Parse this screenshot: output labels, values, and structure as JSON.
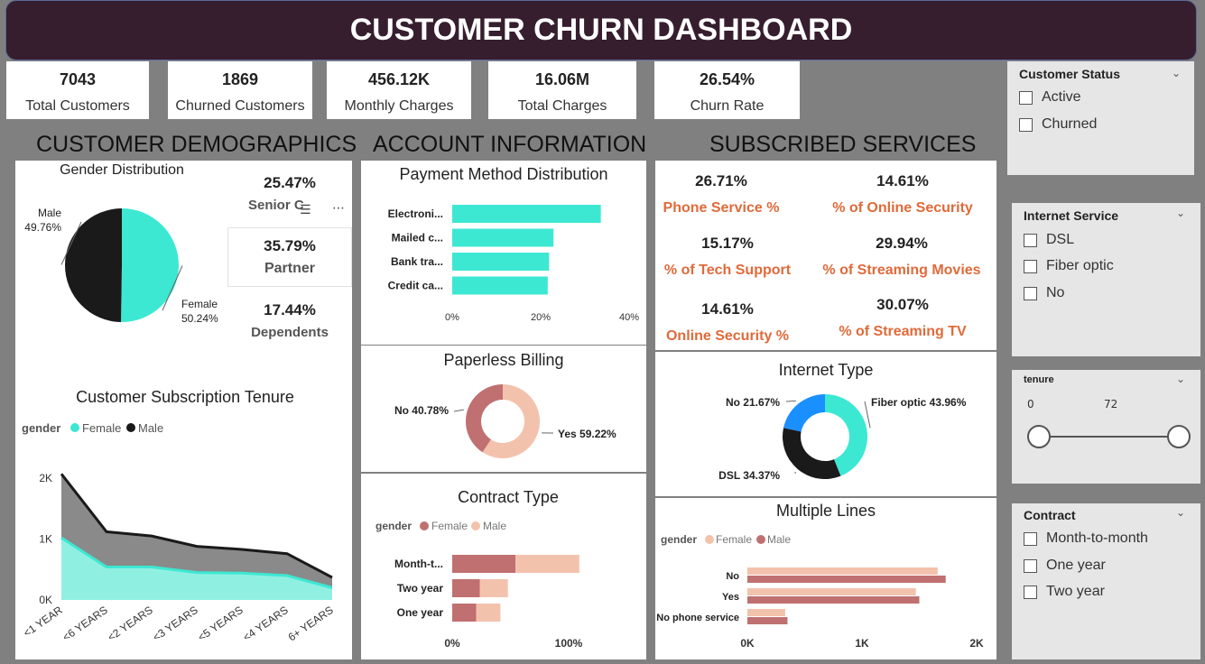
{
  "header": {
    "title": "CUSTOMER CHURN DASHBOARD"
  },
  "kpis": [
    {
      "value": "7043",
      "label": "Total Customers"
    },
    {
      "value": "1869",
      "label": "Churned Customers"
    },
    {
      "value": "456.12K",
      "label": "Monthly Charges"
    },
    {
      "value": "16.06M",
      "label": "Total Charges"
    },
    {
      "value": "26.54%",
      "label": "Churn Rate"
    }
  ],
  "sections": {
    "demographics": "CUSTOMER DEMOGRAPHICS",
    "account": "ACCOUNT INFORMATION",
    "services": "SUBSCRIBED SERVICES"
  },
  "demo_cards": {
    "senior_value": "25.47%",
    "senior_label": "Senior C",
    "partner_value": "35.79%",
    "partner_label": "Partner",
    "dependents_value": "17.44%",
    "dependents_label": "Dependents"
  },
  "services": [
    {
      "value": "26.71%",
      "label": "Phone Service  %"
    },
    {
      "value": "14.61%",
      "label": "% of Online Security"
    },
    {
      "value": "15.17%",
      "label": "% of Tech Support"
    },
    {
      "value": "29.94%",
      "label": "% of Streaming Movies"
    },
    {
      "value": "14.61%",
      "label": "Online Security %"
    },
    {
      "value": "30.07%",
      "label": "% of Streaming TV"
    }
  ],
  "slicers": {
    "status": {
      "title": "Customer Status",
      "options": [
        "Active",
        "Churned"
      ]
    },
    "internet": {
      "title": "Internet Service",
      "options": [
        "DSL",
        "Fiber optic",
        "No"
      ]
    },
    "tenure": {
      "title": "tenure",
      "min": "0",
      "max": "72"
    },
    "contract": {
      "title": "Contract",
      "options": [
        "Month-to-month",
        "One year",
        "Two year"
      ]
    }
  },
  "colors": {
    "teal": "#3de8d3",
    "black": "#1a1a1a",
    "rose": "#c07070",
    "peach": "#f3c2ad",
    "blue": "#1a8fff",
    "header": "#361e2e",
    "orange": "#e06a3a"
  },
  "chart_data": [
    {
      "type": "pie",
      "title": "Gender Distribution",
      "categories": [
        "Female",
        "Male"
      ],
      "values": [
        50.24,
        49.76
      ],
      "labels": [
        "Female 50.24%",
        "Male 49.76%"
      ]
    },
    {
      "type": "area",
      "title": "Customer Subscription Tenure",
      "legend_title": "gender",
      "categories": [
        "<1 YEAR",
        "<6 YEARS",
        "<2 YEARS",
        "<3 YEARS",
        "<5 YEARS",
        "<4 YEARS",
        "6+ YEARS"
      ],
      "series": [
        {
          "name": "Female",
          "values": [
            1020,
            540,
            540,
            450,
            440,
            400,
            200
          ]
        },
        {
          "name": "Male",
          "values": [
            1050,
            580,
            510,
            430,
            390,
            360,
            170
          ]
        }
      ],
      "ylim": [
        0,
        2000
      ],
      "yticks": [
        "0K",
        "1K",
        "2K"
      ],
      "stacked": true
    },
    {
      "type": "bar",
      "title": "Payment Method Distribution",
      "categories": [
        "Electroni...",
        "Mailed c...",
        "Bank tra...",
        "Credit ca..."
      ],
      "values": [
        33.6,
        22.9,
        21.9,
        21.6
      ],
      "xlim": [
        0,
        40
      ],
      "xticks": [
        "0%",
        "20%",
        "40%"
      ]
    },
    {
      "type": "pie",
      "title": "Paperless Billing",
      "categories": [
        "Yes",
        "No"
      ],
      "values": [
        59.22,
        40.78
      ],
      "labels": [
        "Yes 59.22%",
        "No 40.78%"
      ]
    },
    {
      "type": "bar",
      "title": "Contract Type",
      "legend_title": "gender",
      "categories": [
        "Month-t...",
        "Two year",
        "One year"
      ],
      "series": [
        {
          "name": "Female",
          "values": [
            1930,
            840,
            730
          ]
        },
        {
          "name": "Male",
          "values": [
            1950,
            860,
            740
          ]
        }
      ],
      "stacked": true,
      "xticks": [
        "0%",
        "100%"
      ]
    },
    {
      "type": "pie",
      "title": "Internet Type",
      "categories": [
        "Fiber optic",
        "DSL",
        "No"
      ],
      "values": [
        43.96,
        34.37,
        21.67
      ],
      "labels": [
        "Fiber optic 43.96%",
        "DSL 34.37%",
        "No 21.67%"
      ]
    },
    {
      "type": "bar",
      "title": "Multiple Lines",
      "legend_title": "gender",
      "categories": [
        "No",
        "Yes",
        "No phone service"
      ],
      "series": [
        {
          "name": "Female",
          "values": [
            1660,
            1470,
            330
          ]
        },
        {
          "name": "Male",
          "values": [
            1730,
            1500,
            350
          ]
        }
      ],
      "xlim": [
        0,
        2000
      ],
      "xticks": [
        "0K",
        "1K",
        "2K"
      ]
    }
  ]
}
